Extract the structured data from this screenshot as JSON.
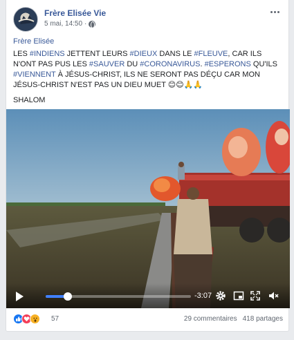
{
  "post": {
    "page_name": "Frère Elisée Vie",
    "timestamp": "5 mai, 14:50",
    "author_line": "Frère Elisée",
    "text_segments": [
      {
        "t": "LES ",
        "tag": false
      },
      {
        "t": "#INDIENS",
        "tag": true
      },
      {
        "t": " JETTENT LEURS ",
        "tag": false
      },
      {
        "t": "#DIEUX",
        "tag": true
      },
      {
        "t": " DANS LE ",
        "tag": false
      },
      {
        "t": "#FLEUVE",
        "tag": true
      },
      {
        "t": ", CAR ILS N'ONT PAS PUS LES ",
        "tag": false
      },
      {
        "t": "#SAUVER",
        "tag": true
      },
      {
        "t": " DU ",
        "tag": false
      },
      {
        "t": "#CORONAVIRUS",
        "tag": true
      },
      {
        "t": ". ",
        "tag": false
      },
      {
        "t": "#ESPERONS",
        "tag": true
      },
      {
        "t": " QU'ILS ",
        "tag": false
      },
      {
        "t": "#VIENNENT",
        "tag": true
      },
      {
        "t": " À JÉSUS-CHRIST, ILS NE SERONT PAS DÉÇU CAR MON JÉSUS-CHRIST N'EST PAS UN DIEU MUET 😊😊🙏🙏",
        "tag": false
      }
    ],
    "closing": "SHALOM"
  },
  "video": {
    "time_remaining": "-3:07",
    "progress": 0.15
  },
  "footer": {
    "reaction_count": "57",
    "comments": "29 commentaires",
    "shares": "418 partages"
  }
}
